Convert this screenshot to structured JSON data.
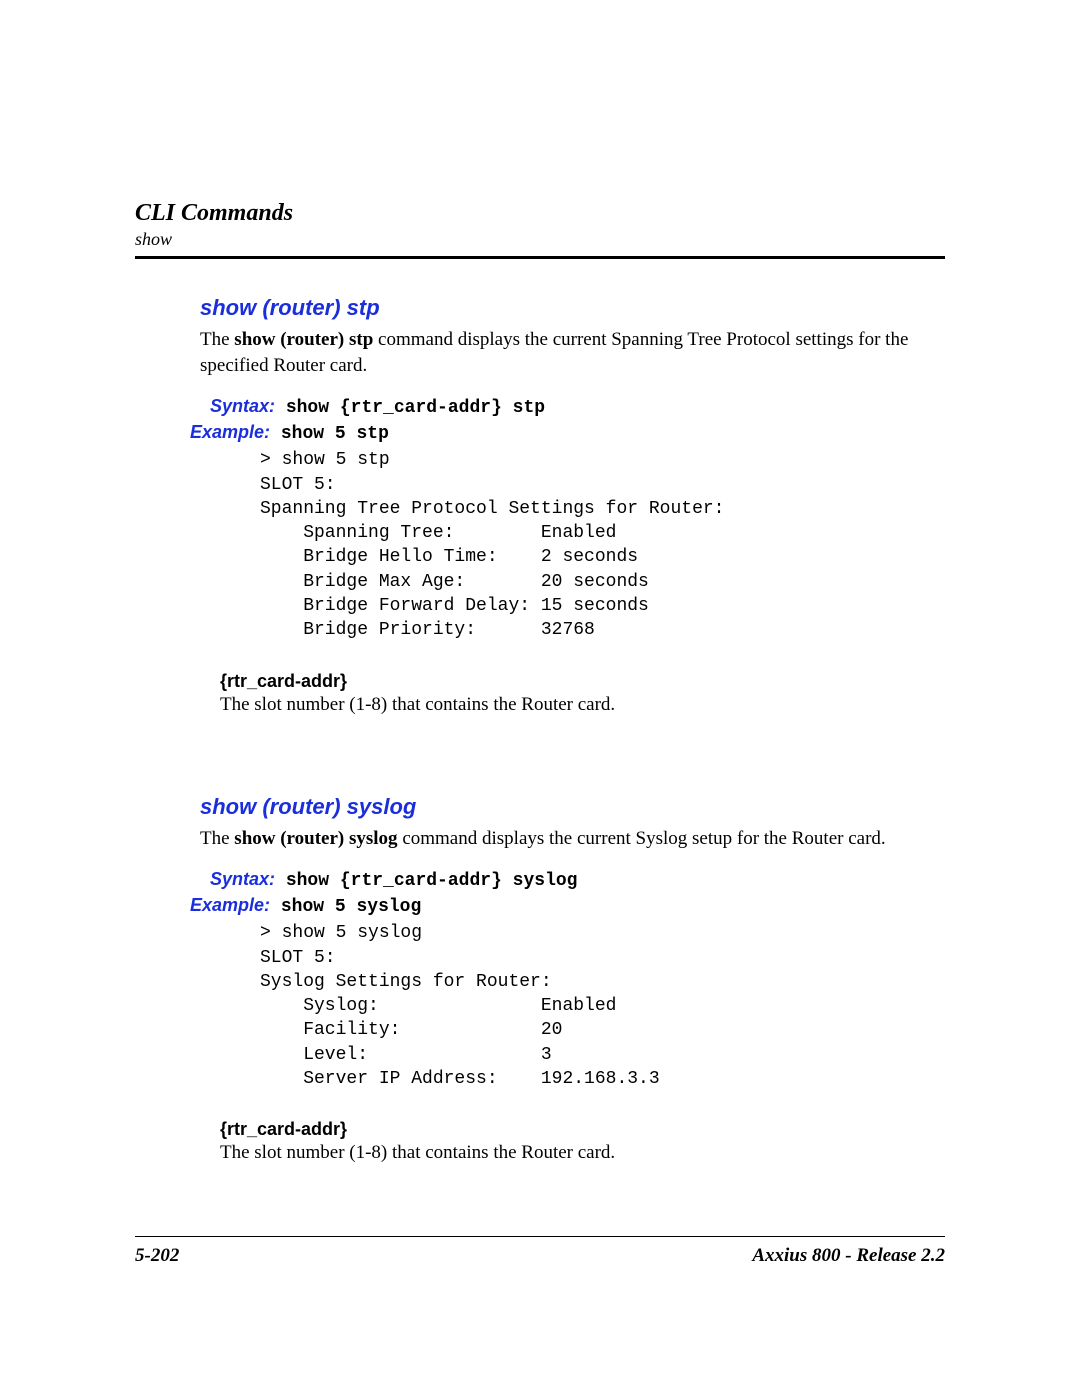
{
  "header": {
    "chapter": "CLI Commands",
    "subsection": "show"
  },
  "sections": [
    {
      "title": "show (router) stp",
      "desc_prefix": "The ",
      "desc_bold": "show (router) stp",
      "desc_suffix": " command displays the current Spanning Tree Protocol settings for the specified Router card.",
      "syntax_label": "Syntax:",
      "syntax_code": " show {rtr_card-addr} stp",
      "example_label": "Example:",
      "example_code": " show 5 stp",
      "output": "> show 5 stp\nSLOT 5:\nSpanning Tree Protocol Settings for Router:\n    Spanning Tree:        Enabled\n    Bridge Hello Time:    2 seconds\n    Bridge Max Age:       20 seconds\n    Bridge Forward Delay: 15 seconds\n    Bridge Priority:      32768",
      "param_name": "{rtr_card-addr}",
      "param_desc": "The slot number (1-8) that contains the Router card."
    },
    {
      "title": "show (router) syslog",
      "desc_prefix": "The ",
      "desc_bold": "show (router) syslog",
      "desc_suffix": " command displays the current Syslog setup for the Router card.",
      "syntax_label": "Syntax:",
      "syntax_code": " show {rtr_card-addr} syslog",
      "example_label": "Example:",
      "example_code": " show 5 syslog",
      "output": "> show 5 syslog\nSLOT 5:\nSyslog Settings for Router:\n    Syslog:               Enabled\n    Facility:             20\n    Level:                3\n    Server IP Address:    192.168.3.3",
      "param_name": "{rtr_card-addr}",
      "param_desc": "The slot number (1-8) that contains the Router card."
    }
  ],
  "footer": {
    "page": "5-202",
    "product": "Axxius 800 - Release 2.2"
  }
}
